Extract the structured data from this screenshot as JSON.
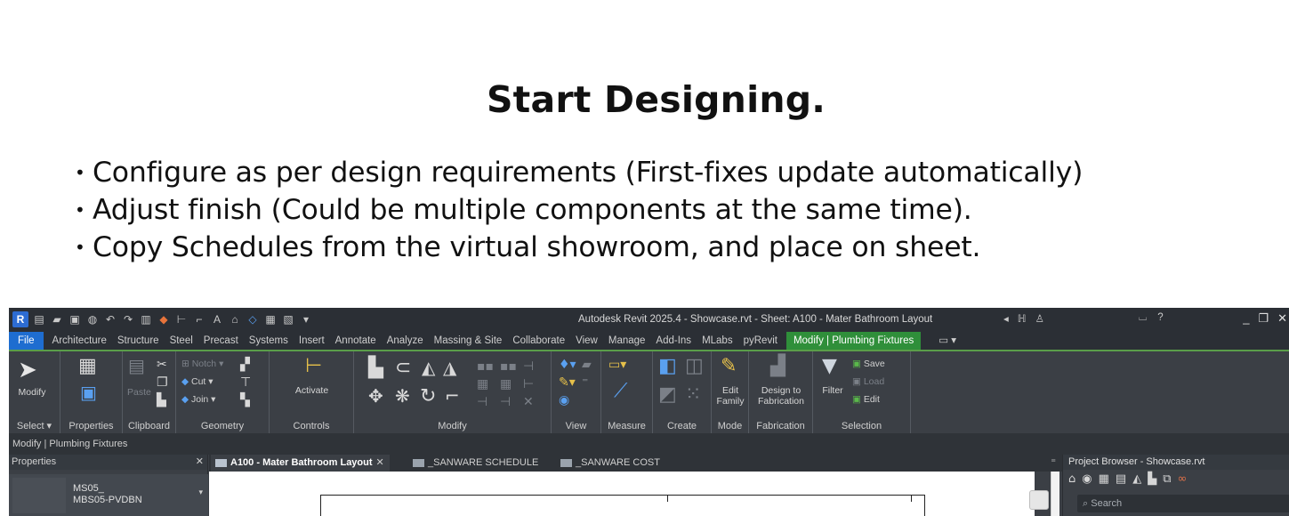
{
  "slide": {
    "title": "Start Designing.",
    "bullets": [
      "Configure as per design requirements (First-fixes update automatically)",
      "Adjust finish (Could be multiple components at the same time).",
      "Copy Schedules from the virtual showroom, and place on sheet."
    ],
    "bullet_glyph": "•"
  },
  "app": {
    "logo": "R",
    "window_title": "Autodesk Revit 2025.4 - Showcase.rvt - Sheet: A100 - Mater Bathroom Layout",
    "menu_tabs": [
      "File",
      "Architecture",
      "Structure",
      "Steel",
      "Precast",
      "Systems",
      "Insert",
      "Annotate",
      "Analyze",
      "Massing & Site",
      "Collaborate",
      "View",
      "Manage",
      "Add-Ins",
      "MLabs",
      "pyRevit"
    ],
    "context_tab": "Modify | Plumbing Fixtures",
    "ribbon": {
      "select_panel": {
        "button": "Modify",
        "label": "Select ▾"
      },
      "properties_panel": {
        "label": "Properties"
      },
      "clipboard_panel": {
        "paste": "Paste",
        "label": "Clipboard"
      },
      "geometry_panel": {
        "notch": "Notch",
        "cut": "Cut",
        "join": "Join",
        "label": "Geometry"
      },
      "controls_panel": {
        "activate": "Activate",
        "label": "Controls"
      },
      "modify_panel": {
        "label": "Modify"
      },
      "view_panel": {
        "label": "View"
      },
      "measure_panel": {
        "label": "Measure"
      },
      "create_panel": {
        "label": "Create"
      },
      "mode_panel": {
        "edit_family": "Edit Family",
        "label": "Mode"
      },
      "fabrication_panel": {
        "design_to_fabrication": "Design to Fabrication",
        "label": "Fabrication"
      },
      "selection_panel": {
        "filter": "Filter",
        "save": "Save",
        "load": "Load",
        "edit": "Edit",
        "label": "Selection"
      }
    },
    "status_text": "Modify | Plumbing Fixtures",
    "properties": {
      "title": "Properties",
      "type_line1": "MS05_",
      "type_line2": "MBS05-PVDBN"
    },
    "view_tabs": [
      {
        "label": "A100 - Mater Bathroom Layout",
        "active": true
      },
      {
        "label": "_SANWARE SCHEDULE",
        "active": false
      },
      {
        "label": "_SANWARE COST",
        "active": false
      }
    ],
    "project_browser": {
      "title": "Project Browser - Showcase.rvt",
      "search_placeholder": "Search"
    }
  },
  "colors": {
    "file_tab": "#1e6dd0",
    "context_tab": "#2f8f3a",
    "ribbon_bg": "#3b3f45",
    "titlebar_bg": "#2b2f35"
  }
}
